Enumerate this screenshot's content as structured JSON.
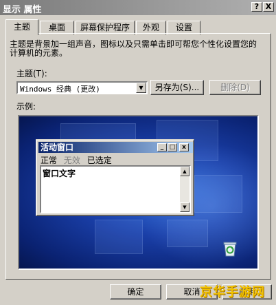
{
  "window": {
    "title": "显示 属性",
    "help_label": "?",
    "close_label": "X"
  },
  "tabs": [
    {
      "label": "主题"
    },
    {
      "label": "桌面"
    },
    {
      "label": "屏幕保护程序"
    },
    {
      "label": "外观"
    },
    {
      "label": "设置"
    }
  ],
  "theme_tab": {
    "description": "主题是背景加一组声音，图标以及只需单击即可帮您个性化设置您的计算机的元素。",
    "theme_label": "主题(T):",
    "theme_value": "Windows 经典 (更改)",
    "save_as_label": "另存为(S)...",
    "delete_label": "删除(D)",
    "sample_label": "示例:"
  },
  "preview": {
    "active_window_title": "活动窗口",
    "menu_items": [
      {
        "label": "正常",
        "disabled": false
      },
      {
        "label": "无效",
        "disabled": true
      },
      {
        "label": "已选定",
        "disabled": false
      }
    ],
    "window_text": "窗口文字"
  },
  "buttons": {
    "ok_label": "确定",
    "cancel_label": "取消",
    "apply_label": "应用"
  },
  "watermark": "京华手游网",
  "colors": {
    "face": "#d4d0c8",
    "active_title_start": "#0a246a",
    "active_title_end": "#a6caf0",
    "desktop": "#1a3fa8"
  }
}
